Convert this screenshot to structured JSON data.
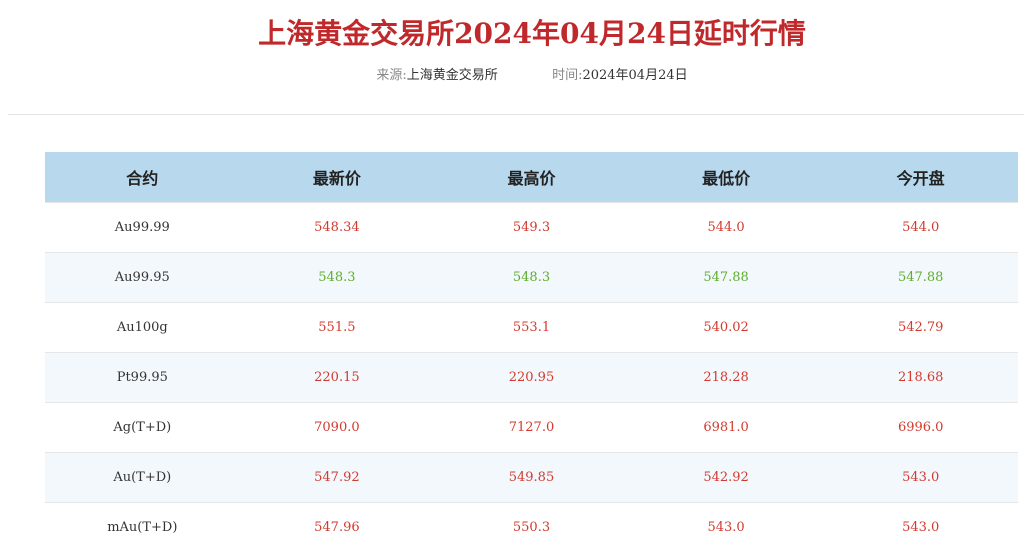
{
  "header": {
    "title": "上海黄金交易所2024年04月24日延时行情",
    "source_label": "来源:",
    "source_value": "上海黄金交易所",
    "time_label": "时间:",
    "time_value": "2024年04月24日"
  },
  "table": {
    "columns": [
      "合约",
      "最新价",
      "最高价",
      "最低价",
      "今开盘"
    ],
    "rows": [
      {
        "name": "Au99.99",
        "latest": "548.34",
        "high": "549.3",
        "low": "544.0",
        "open": "544.0",
        "trend": "up"
      },
      {
        "name": "Au99.95",
        "latest": "548.3",
        "high": "548.3",
        "low": "547.88",
        "open": "547.88",
        "trend": "down"
      },
      {
        "name": "Au100g",
        "latest": "551.5",
        "high": "553.1",
        "low": "540.02",
        "open": "542.79",
        "trend": "up"
      },
      {
        "name": "Pt99.95",
        "latest": "220.15",
        "high": "220.95",
        "low": "218.28",
        "open": "218.68",
        "trend": "up"
      },
      {
        "name": "Ag(T+D)",
        "latest": "7090.0",
        "high": "7127.0",
        "low": "6981.0",
        "open": "6996.0",
        "trend": "up"
      },
      {
        "name": "Au(T+D)",
        "latest": "547.92",
        "high": "549.85",
        "low": "542.92",
        "open": "543.0",
        "trend": "up"
      },
      {
        "name": "mAu(T+D)",
        "latest": "547.96",
        "high": "550.3",
        "low": "543.0",
        "open": "543.0",
        "trend": "up"
      }
    ]
  },
  "colors": {
    "title": "#c0292b",
    "up": "#d23a2f",
    "down": "#5fae2e",
    "header_bg": "#b8d8ee"
  }
}
